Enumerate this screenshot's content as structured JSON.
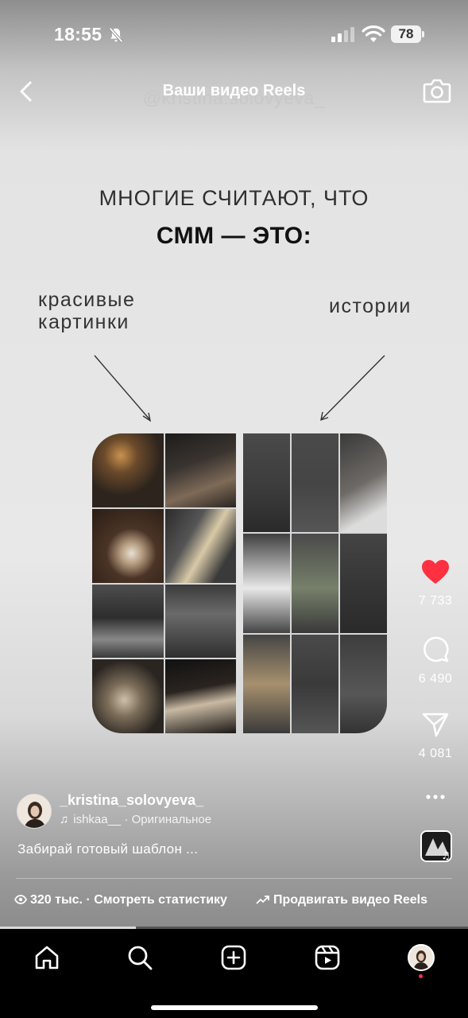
{
  "status_bar": {
    "time": "18:55",
    "battery": "78"
  },
  "header": {
    "title": "Ваши видео Reels",
    "back_icon": "chevron-left-icon",
    "camera_icon": "camera-icon"
  },
  "reel": {
    "watermark": "@kristina.solovyeva_",
    "headline_line1": "МНОГИЕ СЧИТАЮТ, ЧТО",
    "headline_line2": "СММ — ЭТО:",
    "label_left_line1": "красивые",
    "label_left_line2": "картинки",
    "label_right": "истории",
    "progress_fraction": 0.29
  },
  "actions": {
    "likes": "7 733",
    "comments": "6 490",
    "shares": "4 081",
    "like_color": "#ff3040"
  },
  "author": {
    "username": "_kristina_solovyeva_",
    "audio_handle": "ishkaa__",
    "audio_sep": " · ",
    "audio_title": "Оригинальное",
    "caption": "Забирай готовый шаблон ..."
  },
  "footer": {
    "views": "320 тыс.",
    "stats_label": "Смотреть статистику",
    "promote_label": "Продвигать видео Reels"
  }
}
